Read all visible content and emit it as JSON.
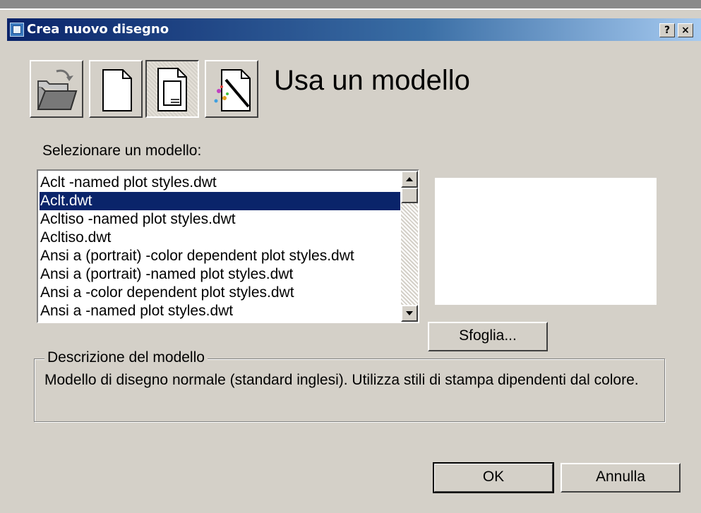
{
  "window": {
    "title": "Crea nuovo disegno",
    "help_button": "?",
    "close_button": "×"
  },
  "mode": {
    "buttons": [
      {
        "name": "open-drawing",
        "icon": "folder-open-icon"
      },
      {
        "name": "start-from-scratch",
        "icon": "blank-page-icon"
      },
      {
        "name": "use-template",
        "icon": "template-icon",
        "pressed": true
      },
      {
        "name": "use-wizard",
        "icon": "wizard-icon"
      }
    ],
    "title": "Usa un modello"
  },
  "templates": {
    "label": "Selezionare un modello:",
    "items": [
      "Aclt -named plot styles.dwt",
      "Aclt.dwt",
      "Acltiso -named plot styles.dwt",
      "Acltiso.dwt",
      "Ansi a (portrait) -color dependent plot styles.dwt",
      "Ansi a (portrait) -named plot styles.dwt",
      "Ansi a -color dependent plot styles.dwt",
      "Ansi a -named plot styles.dwt"
    ],
    "selected_index": 1
  },
  "browse_button": "Sfoglia...",
  "description": {
    "legend": "Descrizione del modello",
    "text": "Modello di disegno normale (standard inglesi). Utilizza stili di stampa dipendenti dal colore."
  },
  "footer": {
    "ok": "OK",
    "cancel": "Annulla"
  },
  "colors": {
    "face": "#d4d0c8",
    "title_start": "#0a246a",
    "title_end": "#a6caf0",
    "selection": "#0a246a"
  }
}
